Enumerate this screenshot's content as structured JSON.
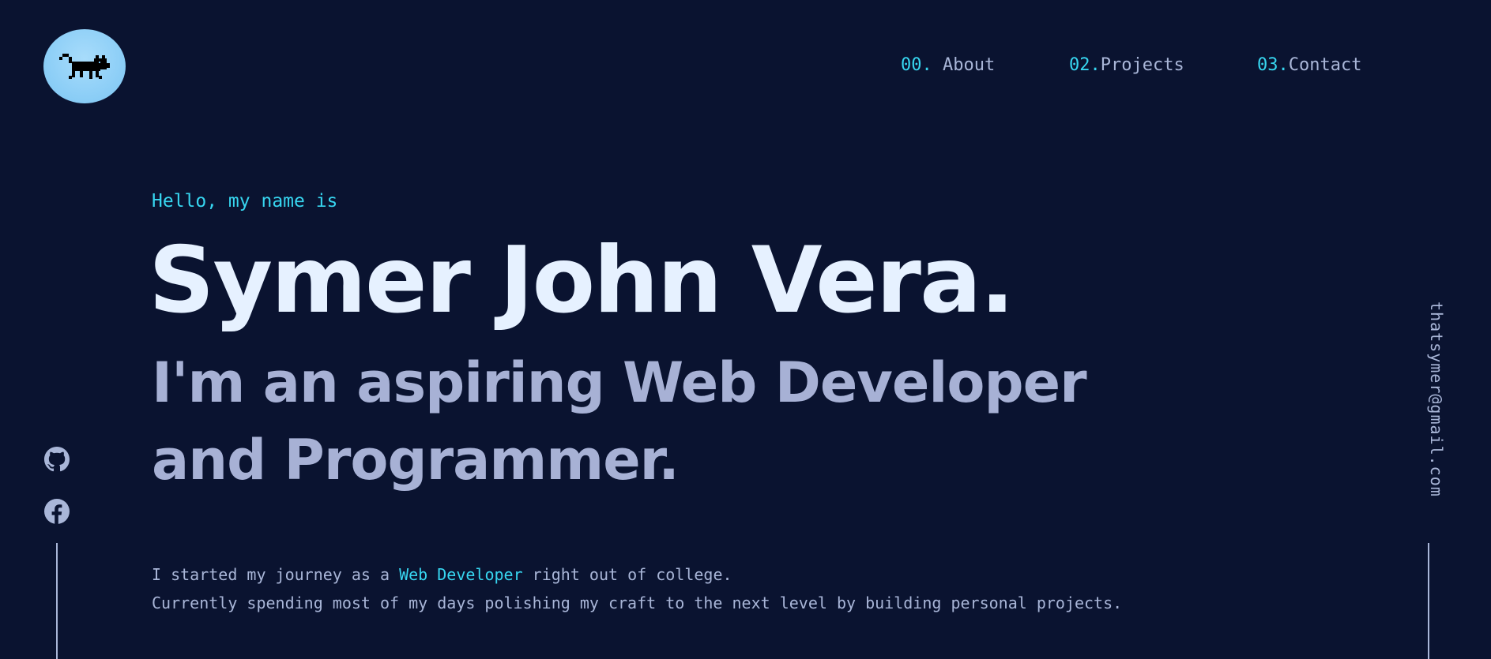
{
  "nav": {
    "about": {
      "num": "00.",
      "label": " About"
    },
    "projects": {
      "num": "02.",
      "label": "Projects"
    },
    "contact": {
      "num": "03.",
      "label": "Contact"
    }
  },
  "hero": {
    "greeting": "Hello, my name is",
    "name": "Symer John Vera.",
    "tagline": "I'm an aspiring Web Developer and Programmer."
  },
  "bio": {
    "line1_prefix": "I started my journey as a ",
    "line1_highlight": "Web Developer",
    "line1_suffix": " right out of college.",
    "line2": "Currently spending most of my days polishing my craft to the next level by building personal projects."
  },
  "email": "thatsymer@gmail.com",
  "icons": {
    "logo": "pixel-cat-icon",
    "github": "github-icon",
    "facebook": "facebook-icon"
  },
  "colors": {
    "background": "#0a1330",
    "accent": "#37d6f0",
    "heading": "#e6f1ff",
    "subheading": "#a7b1d5",
    "text": "#a9b6d8"
  }
}
